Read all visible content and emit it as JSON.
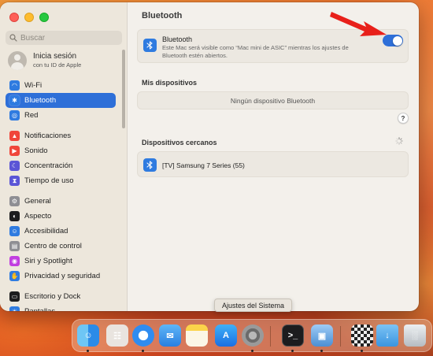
{
  "window": {
    "title": "Bluetooth"
  },
  "sidebar": {
    "search_placeholder": "Buscar",
    "account": {
      "name": "Inicia sesión",
      "subtitle": "con tu ID de Apple"
    },
    "items": [
      {
        "label": "Wi-Fi",
        "icon": "wifi-icon",
        "color": "#2f7be0"
      },
      {
        "label": "Bluetooth",
        "icon": "bluetooth-icon",
        "color": "#2f7be0",
        "active": true
      },
      {
        "label": "Red",
        "icon": "globe-icon",
        "color": "#2f7be0"
      },
      {
        "label": "Notificaciones",
        "icon": "bell-icon",
        "color": "#f0453a"
      },
      {
        "label": "Sonido",
        "icon": "speaker-icon",
        "color": "#f0453a"
      },
      {
        "label": "Concentración",
        "icon": "moon-icon",
        "color": "#5b55d6"
      },
      {
        "label": "Tiempo de uso",
        "icon": "hourglass-icon",
        "color": "#5b55d6"
      },
      {
        "label": "General",
        "icon": "gear-icon",
        "color": "#8e8e93"
      },
      {
        "label": "Aspecto",
        "icon": "appearance-icon",
        "color": "#1c1c1e"
      },
      {
        "label": "Accesibilidad",
        "icon": "accessibility-icon",
        "color": "#2f7be0"
      },
      {
        "label": "Centro de control",
        "icon": "control-center-icon",
        "color": "#8e8e93"
      },
      {
        "label": "Siri y Spotlight",
        "icon": "siri-icon",
        "color": "#c13ee0"
      },
      {
        "label": "Privacidad y seguridad",
        "icon": "hand-icon",
        "color": "#2f7be0"
      },
      {
        "label": "Escritorio y Dock",
        "icon": "desktop-dock-icon",
        "color": "#1c1c1e"
      },
      {
        "label": "Pantallas",
        "icon": "display-icon",
        "color": "#2f7be0"
      }
    ]
  },
  "main": {
    "title": "Bluetooth",
    "bluetooth_card": {
      "title": "Bluetooth",
      "description": "Este Mac será visible como “Mac mini de ASIC” mientras los ajustes de Bluetooth estén abiertos.",
      "enabled": true
    },
    "my_devices": {
      "heading": "Mis dispositivos",
      "empty_text": "Ningún dispositivo Bluetooth"
    },
    "help_label": "?",
    "nearby": {
      "heading": "Dispositivos cercanos",
      "devices": [
        {
          "name": "[TV] Samsung 7 Series (55)"
        }
      ]
    }
  },
  "tooltip": "Ajustes del Sistema",
  "dock": {
    "apps": [
      {
        "name": "finder-icon",
        "running": true
      },
      {
        "name": "launchpad-icon",
        "running": false
      },
      {
        "name": "safari-icon",
        "running": true
      },
      {
        "name": "mail-icon",
        "running": false
      },
      {
        "name": "notes-icon",
        "running": false
      },
      {
        "name": "app-store-icon",
        "running": false
      },
      {
        "name": "system-settings-icon",
        "running": true
      },
      {
        "name": "terminal-icon",
        "running": true
      },
      {
        "name": "preview-icon",
        "running": true
      },
      {
        "name": "chess-icon",
        "running": true
      },
      {
        "name": "downloads-folder-icon",
        "running": false
      },
      {
        "name": "trash-icon",
        "running": false
      }
    ]
  },
  "colors": {
    "accent": "#2e6fd8",
    "annotation_arrow": "#e8201a"
  }
}
